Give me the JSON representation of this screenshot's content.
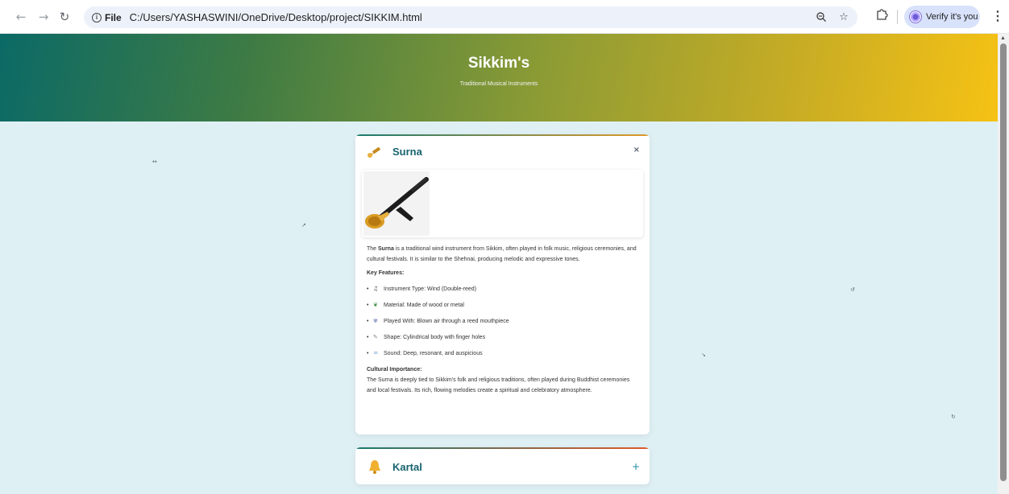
{
  "browser": {
    "url_prefix": "File",
    "url": "C:/Users/YASHASWINI/OneDrive/Desktop/project/SIKKIM.html",
    "verify_label": "Verify it's you",
    "icons": [
      "back-icon",
      "forward-icon",
      "reload-icon",
      "info-icon",
      "zoom-icon",
      "star-icon",
      "extensions-icon",
      "profile-avatar",
      "menu-icon"
    ]
  },
  "hero": {
    "title": "Sikkim's",
    "subtitle": "Traditional Musical Instruments",
    "gradient_colors": [
      "#0b6a66",
      "#3e7b44",
      "#8e9c34",
      "#c9ad24",
      "#f6c214"
    ]
  },
  "floating_glyphs": [
    "↔",
    "↗",
    "↺",
    "↘",
    "↻"
  ],
  "cards": [
    {
      "title": "Surna",
      "toggle": "×",
      "icon": "trumpet-icon",
      "expanded": true,
      "intro_bold": "Surna",
      "intro_pre": "The ",
      "intro_post": " is a traditional wind instrument from Sikkim, often played in folk music, religious ceremonies, and cultural festivals. It is similar to the Shehnai, producing melodic and expressive tones.",
      "features_heading": "Key Features:",
      "features": [
        {
          "icon": "music-note-icon",
          "glyph": "♫",
          "text": "Instrument Type: Wind (Double-reed)"
        },
        {
          "icon": "leaf-icon",
          "glyph": "❦",
          "text": "Material: Made of wood or metal"
        },
        {
          "icon": "wind-icon",
          "glyph": "✾",
          "text": "Played With: Blown air through a reed mouthpiece"
        },
        {
          "icon": "ruler-icon",
          "glyph": "✎",
          "text": "Shape: Cylindrical body with finger holes"
        },
        {
          "icon": "sound-icon",
          "glyph": "♒",
          "text": "Sound: Deep, resonant, and auspicious"
        }
      ],
      "cultural_heading": "Cultural Importance:",
      "cultural_text": "The Surna is deeply tied to Sikkim's folk and religious traditions, often played during Buddhist ceremonies and local festivals. Its rich, flowing melodies create a spiritual and celebratory atmosphere."
    },
    {
      "title": "Kartal",
      "toggle": "+",
      "icon": "bell-icon",
      "expanded": false
    }
  ]
}
